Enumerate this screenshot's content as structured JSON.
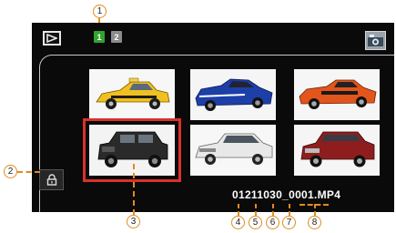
{
  "toolbar": {
    "tab1_label": "1",
    "tab2_label": "2"
  },
  "icons": {
    "play": "play-mode-icon",
    "camera": "camera-mode-icon",
    "lock": "lock-icon"
  },
  "thumbnails": [
    "taxi-car",
    "blue-muscle-car",
    "orange-muscle-car",
    "black-suv",
    "white-suv",
    "red-suv"
  ],
  "selected_index": 3,
  "filename": "01211030_0001.MP4",
  "callouts": [
    "1",
    "2",
    "3",
    "4",
    "5",
    "6",
    "7",
    "8"
  ],
  "colors": {
    "accent": "#e48a1e",
    "selection": "#d8322a",
    "active_tab": "#2fa52f"
  }
}
